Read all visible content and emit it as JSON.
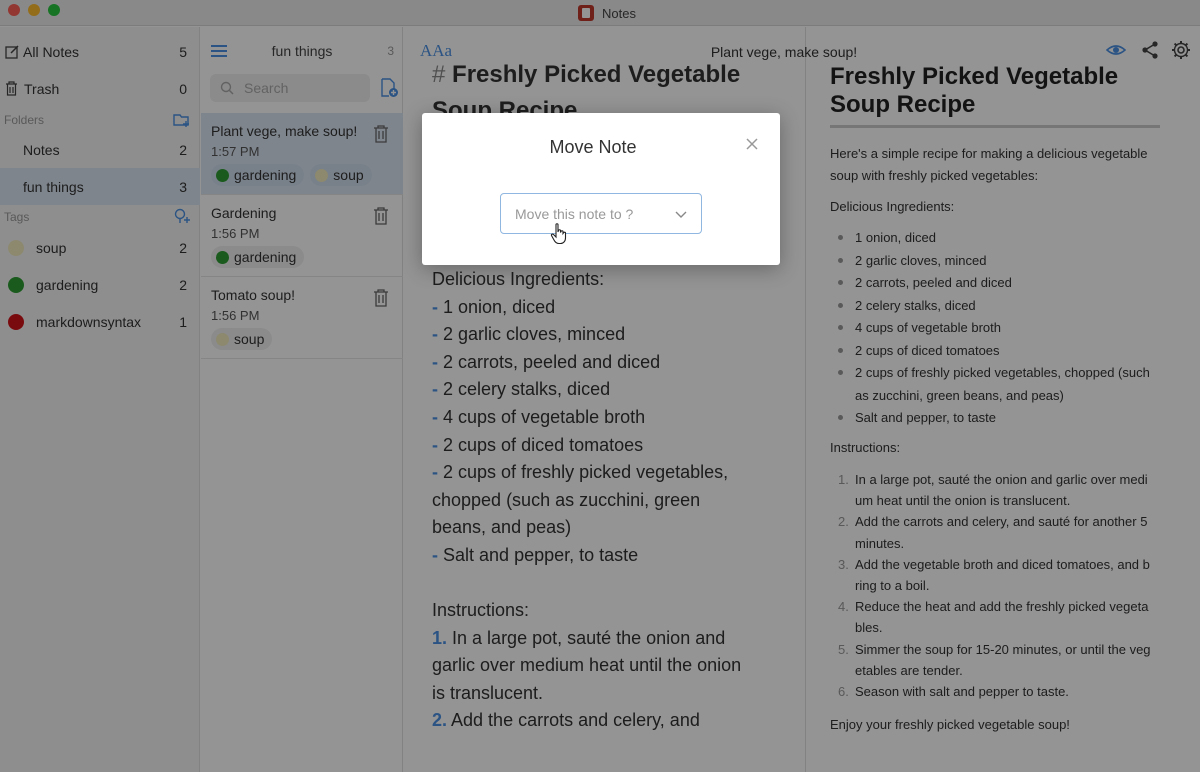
{
  "window": {
    "app_title": "Notes"
  },
  "sidebar": {
    "all_notes": {
      "label": "All Notes",
      "count": "5"
    },
    "trash": {
      "label": "Trash",
      "count": "0"
    },
    "folders_header": "Folders",
    "folders": [
      {
        "label": "Notes",
        "count": "2"
      },
      {
        "label": "fun things",
        "count": "3"
      }
    ],
    "tags_header": "Tags",
    "tags": [
      {
        "label": "soup",
        "count": "2",
        "color": "#f2ecc0"
      },
      {
        "label": "gardening",
        "count": "2",
        "color": "#2e9e32"
      },
      {
        "label": "markdownsyntax",
        "count": "1",
        "color": "#d0141a"
      }
    ]
  },
  "note_list": {
    "folder_title": "fun things",
    "count": "3",
    "search_placeholder": "Search",
    "notes": [
      {
        "title": "Plant vege, make soup!",
        "time": "1:57 PM",
        "tags": [
          "gardening",
          "soup"
        ]
      },
      {
        "title": "Gardening",
        "time": "1:56 PM",
        "tags": [
          "gardening"
        ]
      },
      {
        "title": "Tomato soup!",
        "time": "1:56 PM",
        "tags": [
          "soup"
        ]
      }
    ]
  },
  "toolbar": {
    "font_button": "AAa",
    "note_title": "Plant vege, make soup!"
  },
  "editor": {
    "heading_hash": "#",
    "heading_line1": "Freshly Picked Vegetable",
    "heading_line2": "Soup Recipe",
    "ingredients_heading": "Delicious Ingredients:",
    "ingredients": [
      "1 onion, diced",
      "2 garlic cloves, minced",
      "2 carrots, peeled and diced",
      "2 celery stalks, diced",
      "4 cups of vegetable broth",
      "2 cups of diced tomatoes",
      "2 cups of freshly picked vegetables,",
      "chopped (such as zucchini, green",
      "beans, and peas)",
      "Salt and pepper, to taste"
    ],
    "instructions_heading": "Instructions:",
    "instructions": [
      "In a large pot, sauté the onion and",
      "garlic over medium heat until the onion",
      "is translucent.",
      "Add the carrots and celery, and"
    ],
    "list_marker": "-",
    "num_markers": [
      "1.",
      "2."
    ]
  },
  "preview": {
    "title": "Freshly Picked Vegetable Soup Recipe",
    "intro_line1": "Here's a simple recipe for making a delicious vegetable",
    "intro_line2": "soup with freshly picked vegetables:",
    "ingredients_heading": "Delicious Ingredients:",
    "ingredients": [
      "1 onion, diced",
      "2 garlic cloves, minced",
      "2 carrots, peeled and diced",
      "2 celery stalks, diced",
      "4 cups of vegetable broth",
      "2 cups of diced tomatoes",
      "2 cups of freshly picked vegetables, chopped (such",
      "as zucchini, green beans, and peas)",
      "Salt and pepper, to taste"
    ],
    "instructions_heading": "Instructions:",
    "instructions": [
      {
        "num": "1.",
        "line1": "In a large pot, sauté the onion and garlic over medi",
        "line2": "um heat until the onion is translucent."
      },
      {
        "num": "2.",
        "line1": "Add the carrots and celery, and sauté for another 5",
        "line2": "minutes."
      },
      {
        "num": "3.",
        "line1": "Add the vegetable broth and diced tomatoes, and b",
        "line2": "ring to a boil."
      },
      {
        "num": "4.",
        "line1": "Reduce the heat and add the freshly picked vegeta",
        "line2": "bles."
      },
      {
        "num": "5.",
        "line1": "Simmer the soup for 15-20 minutes, or until the veg",
        "line2": "etables are tender."
      },
      {
        "num": "6.",
        "line1": "Season with salt and pepper to taste.",
        "line2": ""
      }
    ],
    "outro": "Enjoy your freshly picked vegetable soup!"
  },
  "modal": {
    "title": "Move Note",
    "select_placeholder": "Move this note to ?"
  },
  "colors": {
    "accent": "#4a90e2",
    "selection": "#dbe6f3"
  }
}
